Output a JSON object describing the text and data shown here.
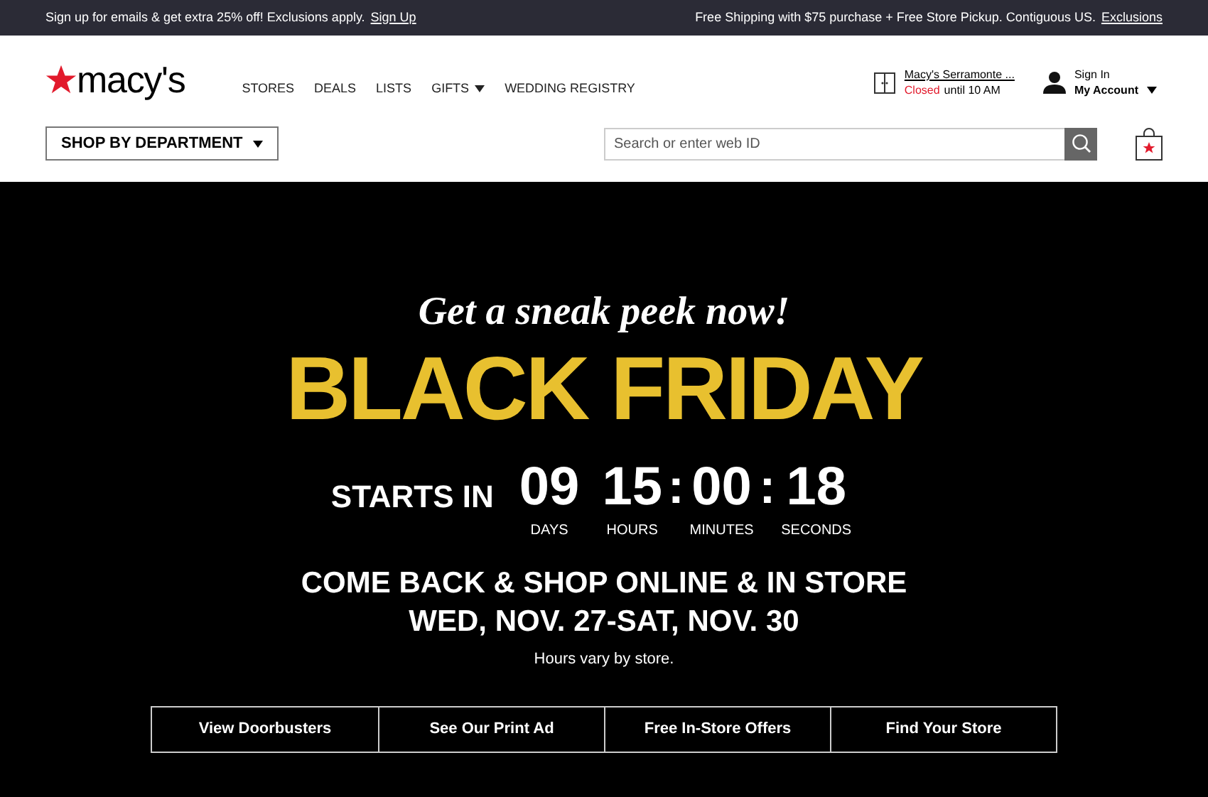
{
  "promo_bar": {
    "left_text": "Sign up for emails & get extra 25% off! Exclusions apply.",
    "left_link": "Sign Up",
    "right_text": "Free Shipping with $75 purchase + Free Store Pickup. Contiguous US.",
    "right_link": "Exclusions"
  },
  "header": {
    "logo": "macy's",
    "nav": [
      {
        "label": "STORES",
        "has_menu": false
      },
      {
        "label": "DEALS",
        "has_menu": false
      },
      {
        "label": "LISTS",
        "has_menu": false
      },
      {
        "label": "GIFTS",
        "has_menu": true
      },
      {
        "label": "WEDDING REGISTRY",
        "has_menu": false
      }
    ],
    "store": {
      "name": "Macy's Serramonte ...",
      "status": "Closed",
      "hours": "until 10 AM"
    },
    "account": {
      "sign_in": "Sign In",
      "label": "My Account"
    },
    "department_button": "SHOP BY DEPARTMENT",
    "search": {
      "placeholder": "Search or enter web ID"
    }
  },
  "hero": {
    "tagline": "Get a sneak peek now!",
    "title": "BLACK FRIDAY",
    "starts_label": "STARTS IN",
    "countdown": [
      {
        "value": "09",
        "unit": "DAYS"
      },
      {
        "value": "15",
        "unit": "HOURS"
      },
      {
        "value": "00",
        "unit": "MINUTES",
        "separator": ":"
      },
      {
        "value": "18",
        "unit": "SECONDS",
        "separator": ":"
      }
    ],
    "headline": [
      "COME BACK & SHOP ONLINE & IN STORE",
      "WED, NOV. 27-SAT, NOV. 30"
    ],
    "note": "Hours vary by store.",
    "buttons": [
      "View Doorbusters",
      "See Our Print Ad",
      "Free In-Store Offers",
      "Find Your Store"
    ]
  }
}
